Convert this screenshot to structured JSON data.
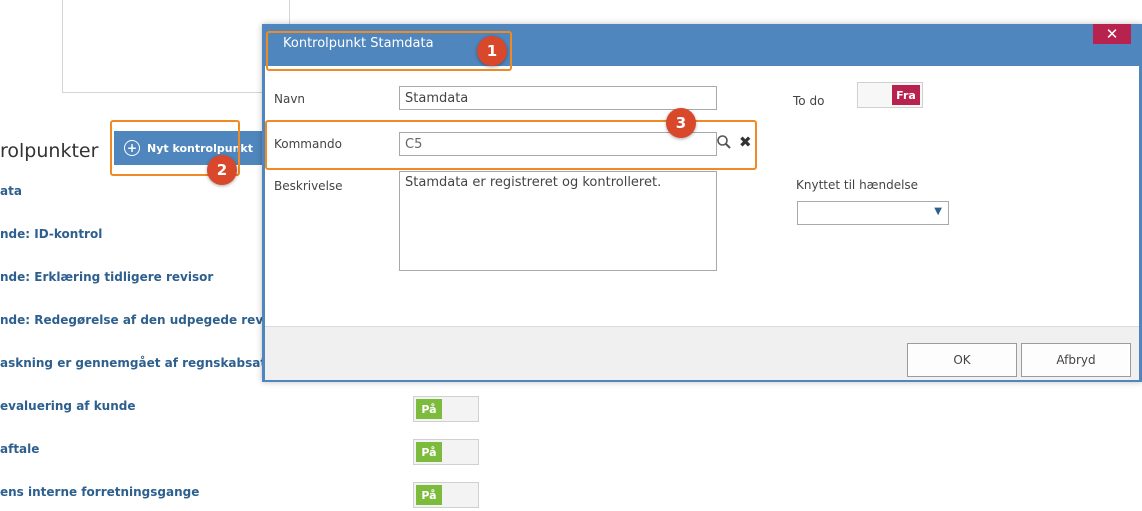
{
  "background": {
    "section_title": "rolpunkter",
    "new_button_label": "Nyt kontrolpunkt",
    "list_items": [
      "ata",
      "nde: ID-kontrol",
      "nde: Erklæring tidligere revisor",
      "nde: Redegørelse af den udpegede rev",
      "askning er gennemgået af regnskabsat",
      "evaluering af kunde",
      "aftale",
      "ens interne forretningsgange"
    ],
    "toggle_on_label": "På",
    "toggle_on_count": 3
  },
  "dialog": {
    "title": "Kontrolpunkt Stamdata",
    "close_icon": "close-icon",
    "navn_label": "Navn",
    "navn_value": "Stamdata",
    "kommando_label": "Kommando",
    "kommando_value": "C5",
    "beskrivelse_label": "Beskrivelse",
    "beskrivelse_value": "Stamdata er registreret og kontrolleret.",
    "todo_label": "To do",
    "todo_value": "Fra",
    "event_label": "Knyttet til hændelse",
    "event_value": "",
    "ok_label": "OK",
    "cancel_label": "Afbryd"
  },
  "callouts": [
    "1",
    "2",
    "3"
  ],
  "colors": {
    "header_blue": "#4f86bd",
    "accent_red": "#b8224f",
    "toggle_green": "#7dbb3c",
    "callout_orange": "#f08a24",
    "badge_red": "#d9482b"
  }
}
